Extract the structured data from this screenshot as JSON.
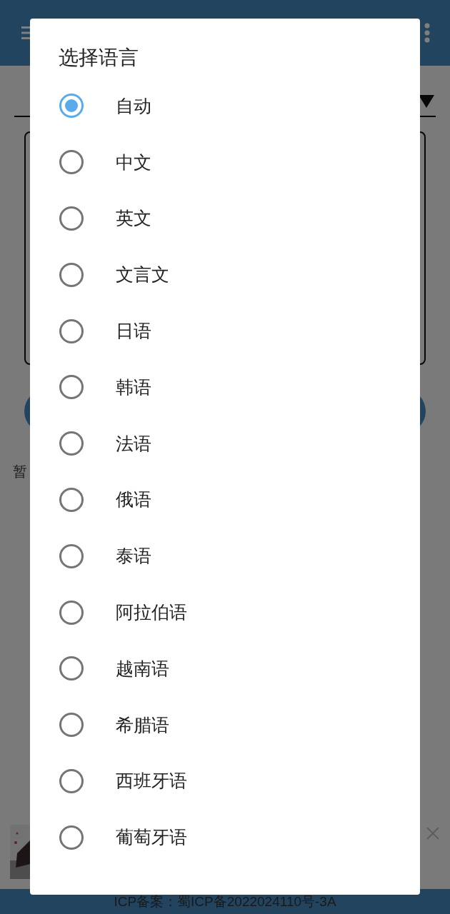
{
  "background": {
    "status_text": "暂",
    "footer": "ICP备案：蜀ICP备2022024110号-3A"
  },
  "dialog": {
    "title": "选择语言",
    "options": [
      {
        "label": "自动",
        "selected": true
      },
      {
        "label": "中文",
        "selected": false
      },
      {
        "label": "英文",
        "selected": false
      },
      {
        "label": "文言文",
        "selected": false
      },
      {
        "label": "日语",
        "selected": false
      },
      {
        "label": "韩语",
        "selected": false
      },
      {
        "label": "法语",
        "selected": false
      },
      {
        "label": "俄语",
        "selected": false
      },
      {
        "label": "泰语",
        "selected": false
      },
      {
        "label": "阿拉伯语",
        "selected": false
      },
      {
        "label": "越南语",
        "selected": false
      },
      {
        "label": "希腊语",
        "selected": false
      },
      {
        "label": "西班牙语",
        "selected": false
      },
      {
        "label": "葡萄牙语",
        "selected": false
      }
    ]
  }
}
